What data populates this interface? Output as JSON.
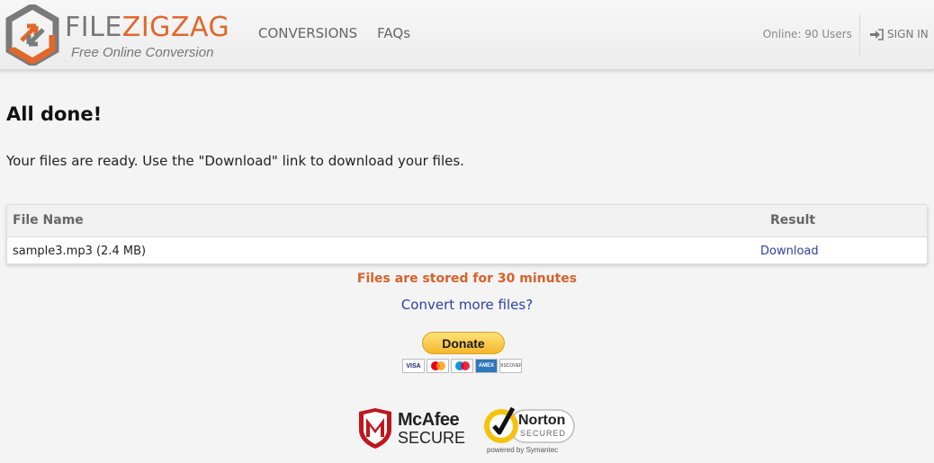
{
  "header": {
    "logo": {
      "word_part1": "FILE",
      "word_part2": "ZIGZAG",
      "tagline": "Free Online Conversion"
    },
    "nav": [
      {
        "label": "CONVERSIONS"
      },
      {
        "label": "FAQs"
      }
    ],
    "online_text": "Online: 90 Users",
    "signin_label": "SIGN IN"
  },
  "main": {
    "title": "All done!",
    "lead": "Your files are ready. Use the \"Download\" link to download your files.",
    "table": {
      "columns": [
        "File Name",
        "Result"
      ],
      "rows": [
        {
          "file": "sample3.mp3 (2.4 MB)",
          "result": "Download"
        }
      ]
    },
    "stored_notice": "Files are stored for 30 minutes",
    "convert_more": "Convert more files?",
    "donate_label": "Donate",
    "cards": [
      "VISA",
      "",
      "",
      "AMEX",
      "DISCOVER"
    ]
  },
  "trust": {
    "mcafee": {
      "line1": "McAfee",
      "line2": "SECURE"
    },
    "norton": {
      "line1": "Norton",
      "line2": "SECURED",
      "powered": "powered by Symantec"
    }
  },
  "colors": {
    "accent": "#e2672b",
    "link": "#2f3fa3",
    "gold": "#f5b72a"
  }
}
